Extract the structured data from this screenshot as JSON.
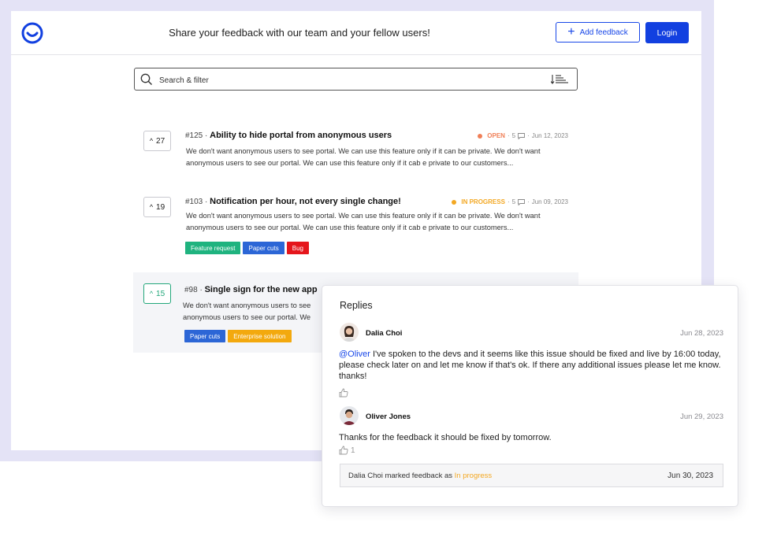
{
  "header": {
    "title": "Share your feedback with our team and your fellow users!",
    "add_feedback_label": "Add feedback",
    "login_label": "Login",
    "brand_color": "#1240e0"
  },
  "search": {
    "placeholder": "Search & filter"
  },
  "posts": [
    {
      "votes": "27",
      "number": "#125",
      "title": "Ability to hide portal from anonymous users",
      "status": "OPEN",
      "status_color": "#f07f57",
      "comments": "5",
      "date": "Jun 12, 2023",
      "description": "We don't want anonymous users to see portal. We can use this feature only if it can be private. We don't want anonymous users to see our portal. We can use this feature only if it cab e private to our customers...",
      "tags": []
    },
    {
      "votes": "19",
      "number": "#103",
      "title": "Notification per hour, not every single change!",
      "status": "IN PROGRESS",
      "status_color": "#f3a823",
      "comments": "5",
      "date": "Jun 09, 2023",
      "description": "We don't want anonymous users to see portal. We can use this feature only if it can be private. We don't want anonymous users to see our portal. We can use this feature only if it cab e private to our customers...",
      "tags": [
        {
          "label": "Feature request",
          "color": "#1fb37f"
        },
        {
          "label": "Paper cuts",
          "color": "#2c66d6"
        },
        {
          "label": "Bug",
          "color": "#e5161c"
        }
      ]
    },
    {
      "votes": "15",
      "number": "#98",
      "title": "Single sign for the new app",
      "description_line1": "We don't want anonymous users to see",
      "description_line2": "anonymous users to see our portal. We",
      "tags": [
        {
          "label": "Paper cuts",
          "color": "#2c66d6"
        },
        {
          "label": "Enterprise solution",
          "color": "#f3a90e"
        }
      ]
    }
  ],
  "replies": {
    "heading": "Replies",
    "items": [
      {
        "author": "Dalia Choi",
        "date": "Jun 28, 2023",
        "mention": "@Oliver",
        "text": " I've spoken to the devs and it seems like this issue should be fixed and live by 16:00 today, please check later on and let me know if that's ok. If there any additional issues please let me know. thanks!",
        "likes": ""
      },
      {
        "author": "Oliver Jones",
        "date": "Jun 29, 2023",
        "text": "Thanks for the feedback it should be fixed by tomorrow.",
        "likes": "1"
      }
    ],
    "activity": {
      "text": "Dalia Choi marked feedback as ",
      "status": "In progress",
      "date": "Jun 30, 2023"
    }
  }
}
